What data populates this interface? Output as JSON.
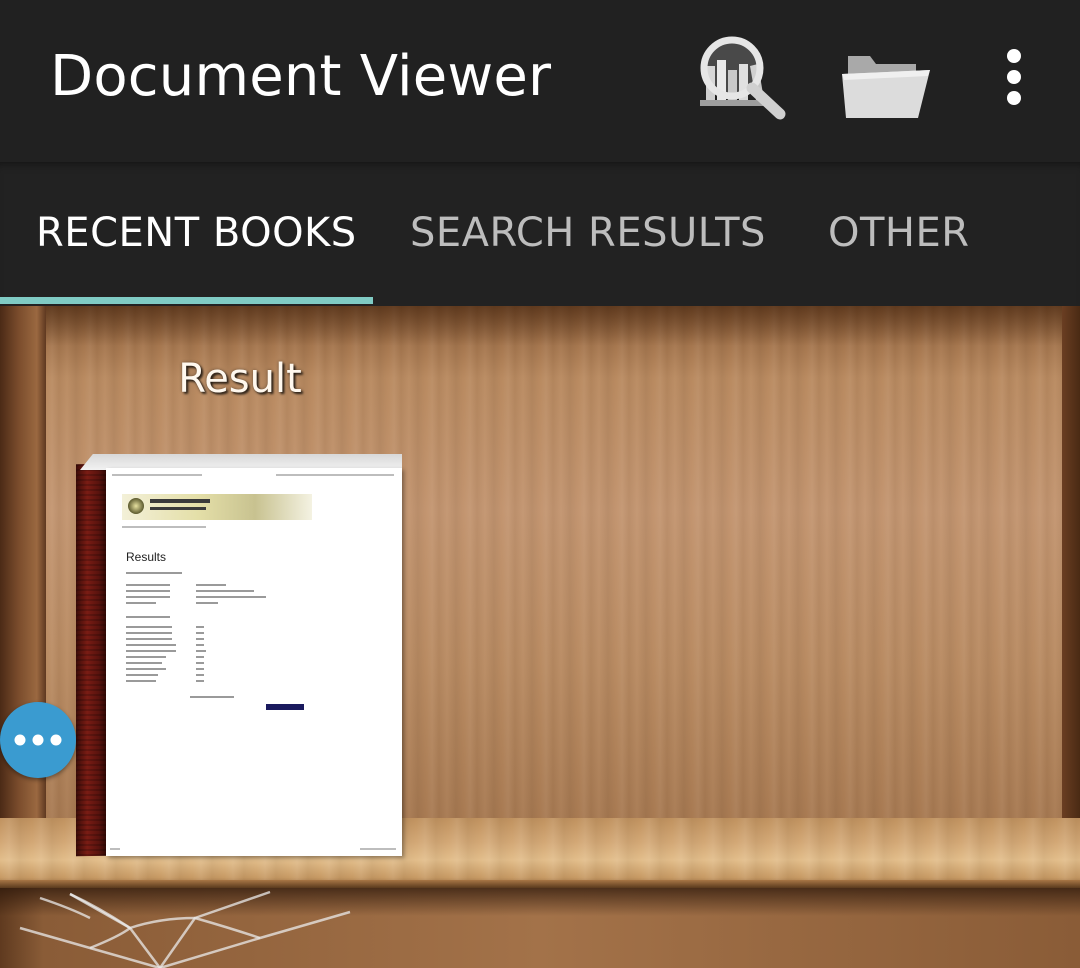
{
  "appbar": {
    "title": "Document Viewer",
    "actions": [
      {
        "name": "search-library",
        "icon": "magnifier-books-icon"
      },
      {
        "name": "open-file",
        "icon": "folder-open-icon"
      },
      {
        "name": "more-options",
        "icon": "overflow-menu-icon"
      }
    ]
  },
  "tabs": [
    {
      "label": "RECENT BOOKS",
      "active": true
    },
    {
      "label": "SEARCH RESULTS",
      "active": false
    },
    {
      "label": "OTHER",
      "active": false
    }
  ],
  "colors": {
    "appbar_bg": "#212121",
    "tab_indicator": "#80cbc4",
    "fab": "#3a9bd0"
  },
  "shelf": {
    "books": [
      {
        "title": "Result",
        "cover_heading": "Results"
      }
    ]
  },
  "fab": {
    "icon": "more-horizontal-icon"
  }
}
